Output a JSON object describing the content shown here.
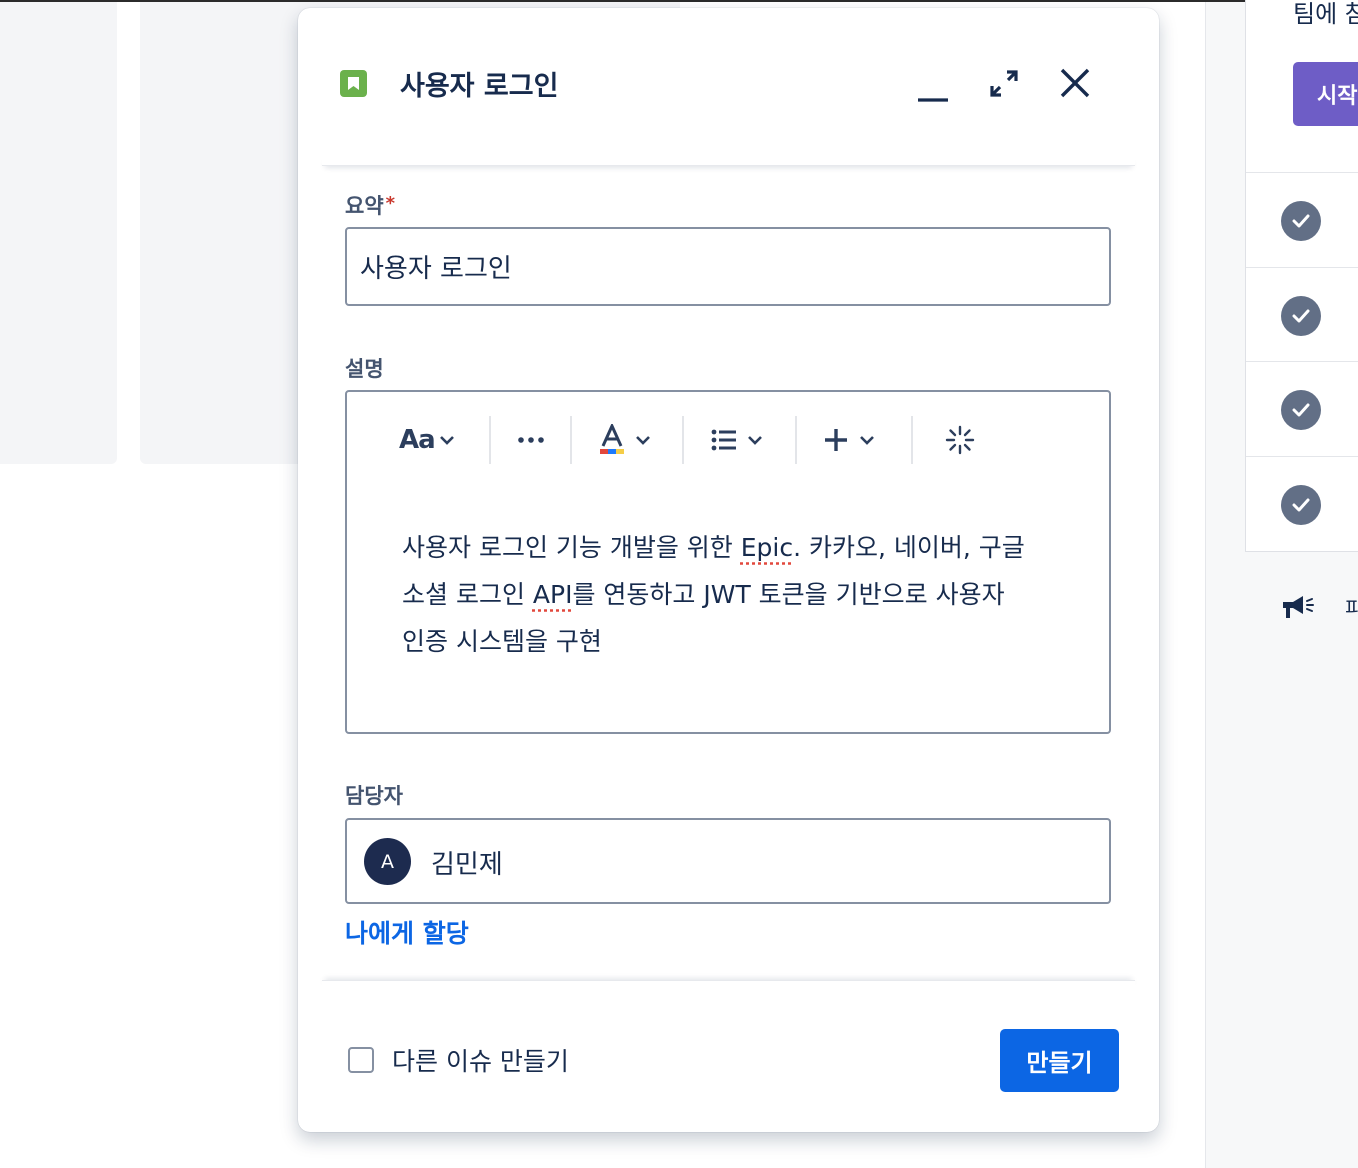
{
  "modal": {
    "title": "사용자 로그인",
    "summary": {
      "label": "요약",
      "required_mark": "*",
      "value": "사용자 로그인"
    },
    "description": {
      "label": "설명",
      "toolbar": {
        "text_style_label": "Aa"
      },
      "text": {
        "line1_pre": "사용자 로그인 기능 개발을 위한 ",
        "line1_spell": "Epic",
        "line1_post": ". 카카오, 네이버, 구글",
        "line2_pre": "소셜 로그인 ",
        "line2_spell": "API",
        "line2_post": "를 연동하고 JWT 토큰을 기반으로 사용자",
        "line3": "인증 시스템을 구현"
      }
    },
    "assignee": {
      "label": "담당자",
      "avatar_initial": "A",
      "name": "김민제",
      "assign_to_me": "나에게 할당"
    },
    "footer": {
      "create_another_label": "다른 이슈 만들기",
      "create_another_checked": false,
      "create_button": "만들기"
    }
  },
  "right_panel": {
    "title_partial": "팀에 참",
    "start_button_partial": "시작",
    "announce_partial": "피"
  },
  "colors": {
    "primary": "#0c66e4",
    "issue_type": "#6bb14c",
    "purple_button": "#6e5dc6",
    "required": "#c9372c"
  }
}
